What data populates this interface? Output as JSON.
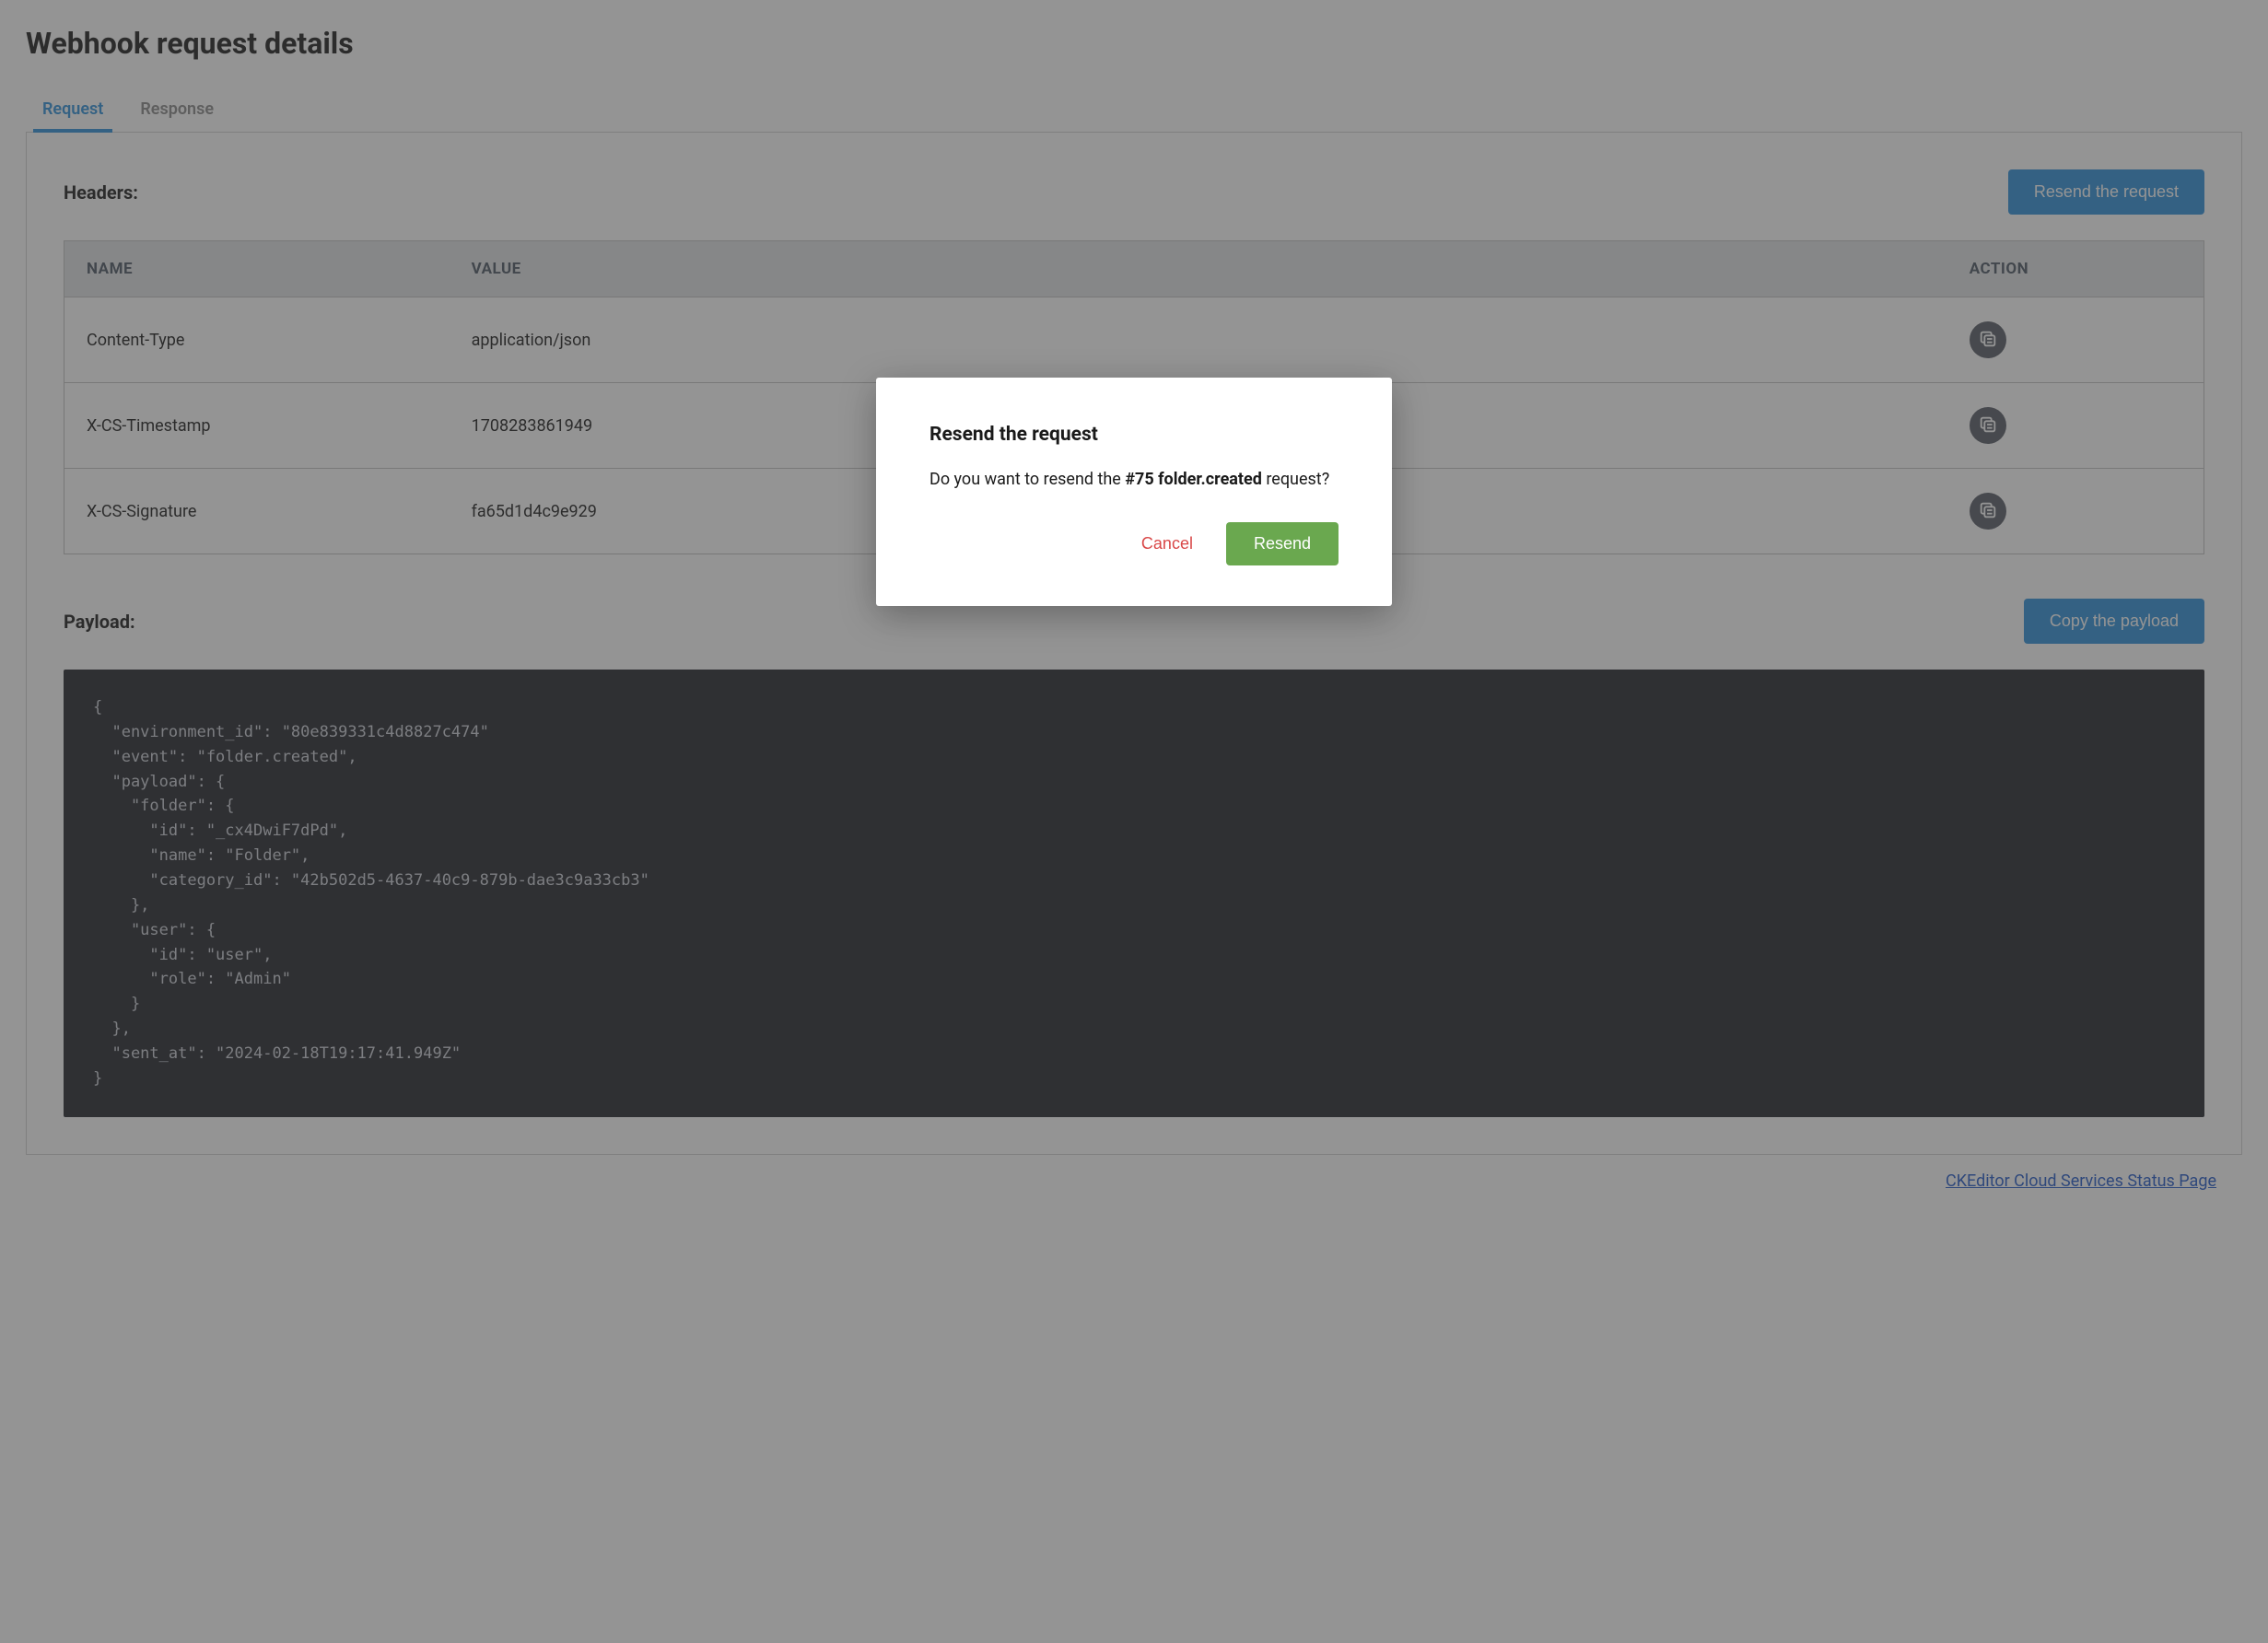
{
  "page": {
    "title": "Webhook request details"
  },
  "tabs": {
    "request": "Request",
    "response": "Response"
  },
  "headers": {
    "label": "Headers:",
    "resend_button": "Resend the request",
    "columns": {
      "name": "NAME",
      "value": "VALUE",
      "action": "ACTION"
    },
    "rows": [
      {
        "name": "Content-Type",
        "value": "application/json"
      },
      {
        "name": "X-CS-Timestamp",
        "value": "1708283861949"
      },
      {
        "name": "X-CS-Signature",
        "value": "fa65d1d4c9e929"
      }
    ]
  },
  "payload": {
    "label": "Payload:",
    "copy_button": "Copy the payload",
    "code": "{\n  \"environment_id\": \"80e839331c4d8827c474\"\n  \"event\": \"folder.created\",\n  \"payload\": {\n    \"folder\": {\n      \"id\": \"_cx4DwiF7dPd\",\n      \"name\": \"Folder\",\n      \"category_id\": \"42b502d5-4637-40c9-879b-dae3c9a33cb3\"\n    },\n    \"user\": {\n      \"id\": \"user\",\n      \"role\": \"Admin\"\n    }\n  },\n  \"sent_at\": \"2024-02-18T19:17:41.949Z\"\n}"
  },
  "footer": {
    "link_text": "CKEditor Cloud Services Status Page"
  },
  "modal": {
    "title": "Resend the request",
    "body_prefix": "Do you want to resend the ",
    "body_bold": "#75 folder.created",
    "body_suffix": " request?",
    "cancel": "Cancel",
    "confirm": "Resend"
  }
}
